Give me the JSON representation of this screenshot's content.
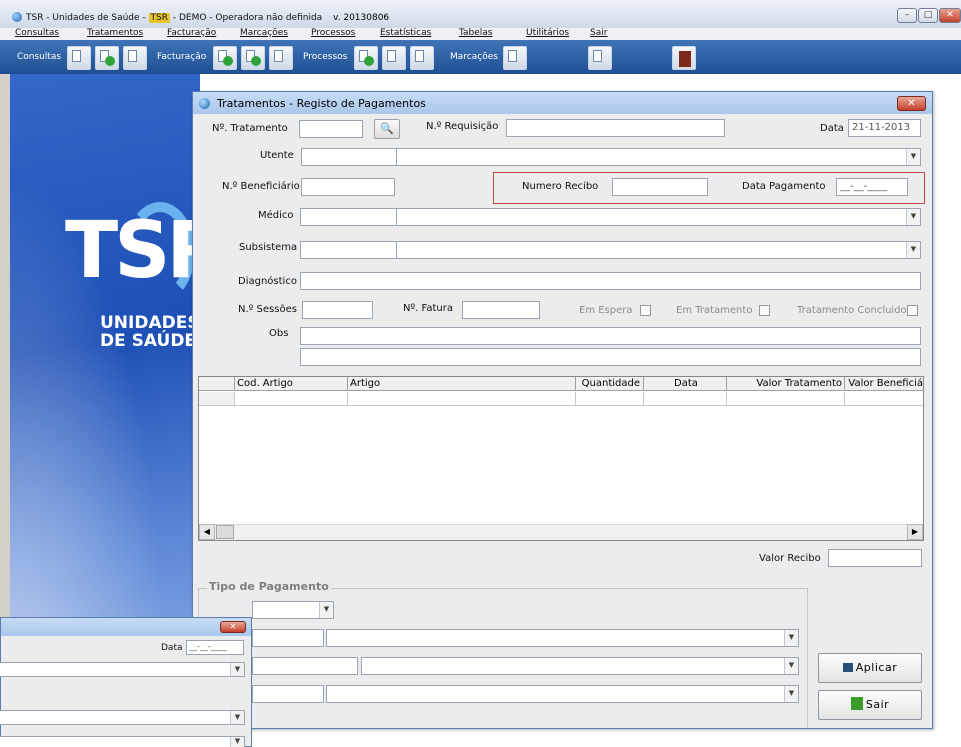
{
  "app": {
    "title_prefix": "TSR - Unidades de Saúde - ",
    "title_highlight": "TSR",
    "title_suffix": " - DEMO - Operadora não definida",
    "version": "v. 20130806"
  },
  "menu": [
    "Consultas",
    "Tratamentos",
    "Facturação",
    "Marcações",
    "Processos",
    "Estatísticas",
    "Tabelas",
    "Utilitários",
    "Sair"
  ],
  "toolbar": {
    "consultas_label": "Consultas",
    "facturacao_label": "Facturação",
    "processos_label": "Processos",
    "marcacoes_label": "Marcações"
  },
  "logo": {
    "main": "TSR",
    "sub1": "UNIDADES",
    "sub2": "DE SAÚDE"
  },
  "dialog": {
    "title": "Tratamentos - Registo de Pagamentos",
    "close": "✕",
    "labels": {
      "n_tratamento": "Nº. Tratamento",
      "n_requisicao": "N.º Requisição",
      "data": "Data",
      "utente": "Utente",
      "n_beneficiario": "N.º Beneficiário",
      "numero_recibo": "Numero Recibo",
      "data_pagamento": "Data Pagamento",
      "medico": "Médico",
      "subsistema": "Subsistema",
      "diagnostico": "Diagnóstico",
      "n_sessoes": "N.º Sessões",
      "n_fatura": "Nº. Fatura",
      "em_espera": "Em Espera",
      "em_tratamento": "Em Tratamento",
      "tratamento_concluido": "Tratamento Concluido",
      "obs": "Obs",
      "valor_recibo": "Valor Recibo",
      "tipo_pagamento": "Tipo de Pagamento"
    },
    "values": {
      "data": "21-11-2013",
      "data_pagamento": "__-__-____"
    },
    "grid": {
      "columns": [
        "Cod. Artigo",
        "Artigo",
        "Quantidade",
        "Data",
        "Valor Tratamento",
        "Valor Beneficiá"
      ]
    },
    "buttons": {
      "aplicar": "Aplicar",
      "sair": "Sair"
    }
  },
  "subwin": {
    "data_label": "Data",
    "data_value": "__-__-____"
  }
}
